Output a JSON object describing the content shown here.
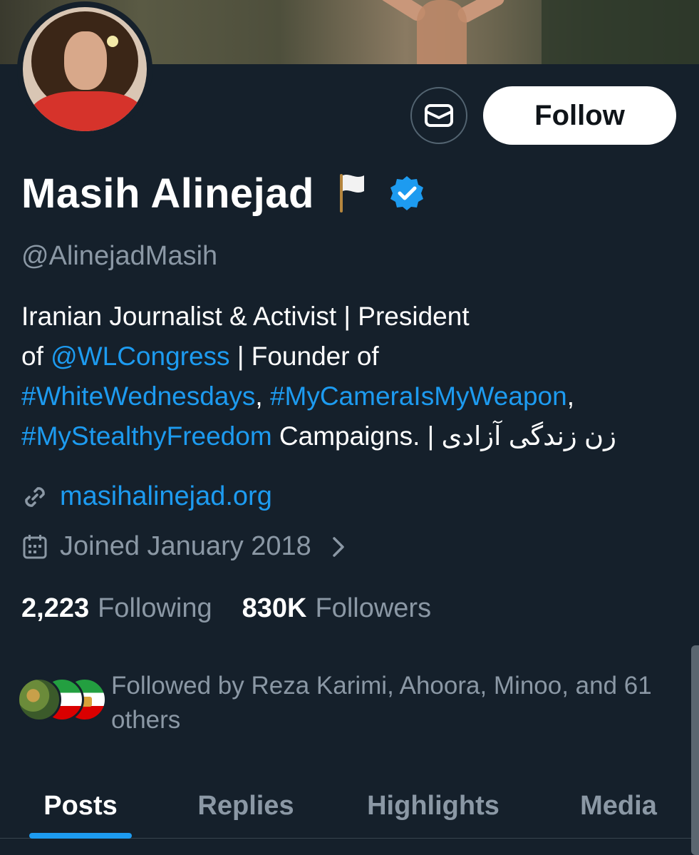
{
  "profile": {
    "name": "Masih Alinejad",
    "handle": "@AlinejadMasih",
    "follow_label": "Follow",
    "verified": true
  },
  "bio": {
    "line1": "Iranian Journalist & Activist | President",
    "line2_prefix": "of ",
    "line2_mention": "@WLCongress",
    "line2_suffix": " | Founder of",
    "line3_tag1": "#WhiteWednesdays",
    "line3_sep": ", ",
    "line3_tag2": "#MyCameraIsMyWeapon",
    "line3_end": ",",
    "line4_tag": "#MyStealthyFreedom",
    "line4_suffix": " Campaigns. | زن زندگی آزادی"
  },
  "meta": {
    "website": "masihalinejad.org",
    "joined": "Joined January 2018"
  },
  "stats": {
    "following_count": "2,223",
    "following_label": "Following",
    "followers_count": "830K",
    "followers_label": "Followers"
  },
  "followed_by": {
    "text": "Followed by Reza Karimi, Ahoora, Minoo, and 61 others"
  },
  "tabs": [
    {
      "label": "Posts",
      "active": true
    },
    {
      "label": "Replies",
      "active": false
    },
    {
      "label": "Highlights",
      "active": false
    },
    {
      "label": "Media",
      "active": false
    }
  ],
  "colors": {
    "background": "#15202b",
    "accent": "#1d9bf0",
    "muted": "#8b98a5"
  }
}
